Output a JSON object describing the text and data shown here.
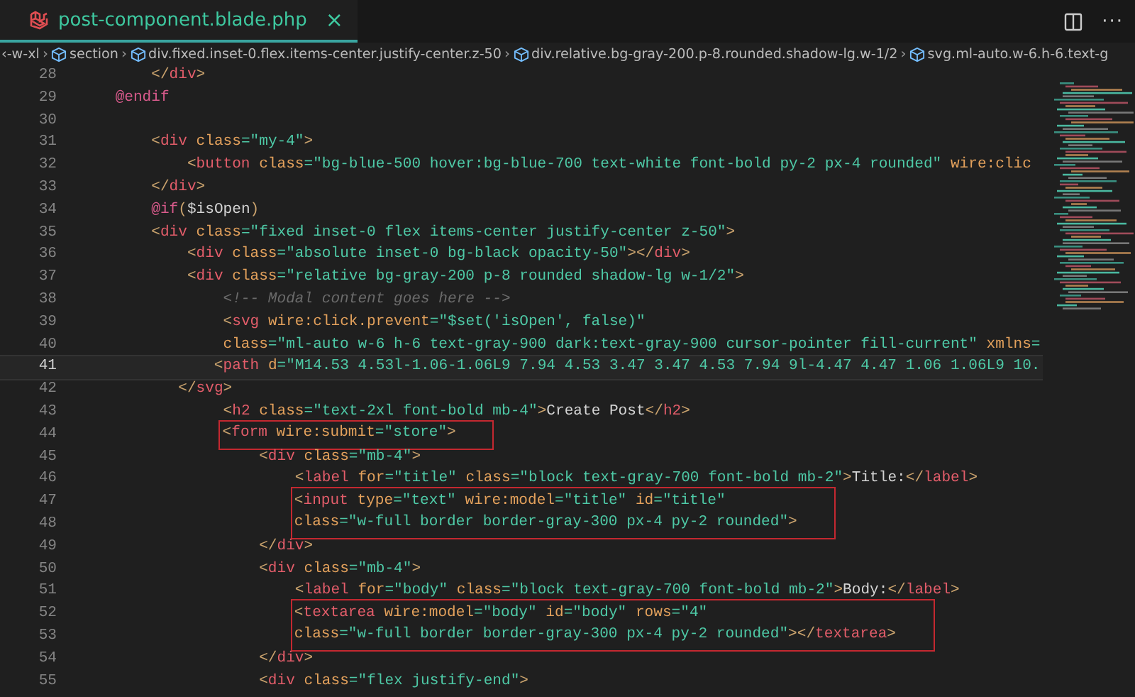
{
  "tab": {
    "title": "post-component.blade.php",
    "close": "×",
    "selected": true
  },
  "toolbar": {
    "more": "···"
  },
  "breadcrumbs": [
    {
      "kind": "plain",
      "text": "‹-w-xl"
    },
    {
      "kind": "symbol",
      "separator": "›",
      "text": "section"
    },
    {
      "kind": "symbol",
      "separator": "›",
      "text": "div.fixed.inset-0.flex.items-center.justify-center.z-50"
    },
    {
      "kind": "symbol",
      "separator": "›",
      "text": "div.relative.bg-gray-200.p-8.rounded.shadow-lg.w-1/2"
    },
    {
      "kind": "symbol",
      "separator": "›",
      "text": "svg.ml-auto.w-6.h-6.text-g"
    }
  ],
  "editor": {
    "blocks": [
      {
        "kind": "line",
        "number": "28",
        "current": false,
        "tokens": [
          {
            "kind": "lt",
            "text": "        </"
          },
          {
            "kind": "tag",
            "text": "div"
          },
          {
            "kind": "lt",
            "text": ">"
          }
        ]
      },
      {
        "kind": "line",
        "number": "29",
        "current": false,
        "tokens": [
          {
            "kind": "dir",
            "text": "    @endif"
          }
        ]
      },
      {
        "kind": "line",
        "number": "30",
        "current": false
      },
      {
        "kind": "line",
        "number": "31",
        "current": false,
        "tokens": [
          {
            "kind": "lt",
            "text": "        <"
          },
          {
            "kind": "tag",
            "text": "div"
          },
          {
            "kind": "attr",
            "text": " class"
          },
          {
            "kind": "str",
            "text": "=\"my-4\""
          },
          {
            "kind": "lt",
            "text": ">"
          }
        ]
      },
      {
        "kind": "line",
        "number": "32",
        "current": false,
        "tokens": [
          {
            "kind": "lt",
            "text": "            <"
          },
          {
            "kind": "tag",
            "text": "button"
          },
          {
            "kind": "attr",
            "text": " class"
          },
          {
            "kind": "str",
            "text": "=\"bg-blue-500 hover:bg-blue-700 text-white font-bold py-2 px-4 rounded\""
          },
          {
            "kind": "attr",
            "text": " wire:clic"
          }
        ]
      },
      {
        "kind": "line",
        "number": "33",
        "current": false,
        "tokens": [
          {
            "kind": "lt",
            "text": "        </"
          },
          {
            "kind": "tag",
            "text": "div"
          },
          {
            "kind": "lt",
            "text": ">"
          }
        ]
      },
      {
        "kind": "line",
        "number": "34",
        "current": false,
        "tokens": [
          {
            "kind": "dir",
            "text": "        @if"
          },
          {
            "kind": "lt",
            "text": "("
          },
          {
            "kind": "txt",
            "text": "$isOpen"
          },
          {
            "kind": "lt",
            "text": ")"
          }
        ]
      },
      {
        "kind": "line",
        "number": "35",
        "current": false,
        "tokens": [
          {
            "kind": "lt",
            "text": "        <"
          },
          {
            "kind": "tag",
            "text": "div"
          },
          {
            "kind": "attr",
            "text": " class"
          },
          {
            "kind": "str",
            "text": "=\"fixed inset-0 flex items-center justify-center z-50\""
          },
          {
            "kind": "lt",
            "text": ">"
          }
        ]
      },
      {
        "kind": "line",
        "number": "36",
        "current": false,
        "tokens": [
          {
            "kind": "lt",
            "text": "            <"
          },
          {
            "kind": "tag",
            "text": "div"
          },
          {
            "kind": "attr",
            "text": " class"
          },
          {
            "kind": "str",
            "text": "=\"absolute inset-0 bg-black opacity-50\""
          },
          {
            "kind": "lt",
            "text": "></"
          },
          {
            "kind": "tag",
            "text": "div"
          },
          {
            "kind": "lt",
            "text": ">"
          }
        ]
      },
      {
        "kind": "line",
        "number": "37",
        "current": false,
        "tokens": [
          {
            "kind": "lt",
            "text": "            <"
          },
          {
            "kind": "tag",
            "text": "div"
          },
          {
            "kind": "attr",
            "text": " class"
          },
          {
            "kind": "str",
            "text": "=\"relative bg-gray-200 p-8 rounded shadow-lg w-1/2\""
          },
          {
            "kind": "lt",
            "text": ">"
          }
        ]
      },
      {
        "kind": "line",
        "number": "38",
        "current": false,
        "tokens": [
          {
            "kind": "com",
            "text": "                <!-- Modal content goes here -->"
          }
        ]
      },
      {
        "kind": "line",
        "number": "39",
        "current": false,
        "tokens": [
          {
            "kind": "lt",
            "text": "                <"
          },
          {
            "kind": "tag",
            "text": "svg"
          },
          {
            "kind": "attr",
            "text": " wire:click.prevent"
          },
          {
            "kind": "str",
            "text": "=\"$set('isOpen', false)\""
          }
        ]
      },
      {
        "kind": "line",
        "number": "40",
        "current": false,
        "tokens": [
          {
            "kind": "attr",
            "text": "                class"
          },
          {
            "kind": "str",
            "text": "=\"ml-auto w-6 h-6 text-gray-900 dark:text-gray-900 cursor-pointer fill-current\""
          },
          {
            "kind": "attr",
            "text": " xmlns"
          },
          {
            "kind": "str",
            "text": "="
          }
        ]
      },
      {
        "kind": "line",
        "number": "41",
        "current": true,
        "tokens": [
          {
            "kind": "lt",
            "text": "               <"
          },
          {
            "kind": "tag",
            "text": "path"
          },
          {
            "kind": "attr",
            "text": " d"
          },
          {
            "kind": "str",
            "text": "=\"M14.53 4.53l-1.06-1.06L9 7.94 4.53 3.47 3.47 4.53 7.94 9l-4.47 4.47 1.06 1.06L9 10."
          }
        ]
      },
      {
        "kind": "line",
        "number": "42",
        "current": false,
        "tokens": [
          {
            "kind": "lt",
            "text": "           </"
          },
          {
            "kind": "tag",
            "text": "svg"
          },
          {
            "kind": "lt",
            "text": ">"
          }
        ]
      },
      {
        "kind": "line",
        "number": "43",
        "current": false,
        "tokens": [
          {
            "kind": "lt",
            "text": "                <"
          },
          {
            "kind": "tag",
            "text": "h2"
          },
          {
            "kind": "attr",
            "text": " class"
          },
          {
            "kind": "str",
            "text": "=\"text-2xl font-bold mb-4\""
          },
          {
            "kind": "lt",
            "text": ">"
          },
          {
            "kind": "txt",
            "text": "Create Post"
          },
          {
            "kind": "lt",
            "text": "</"
          },
          {
            "kind": "tag",
            "text": "h2"
          },
          {
            "kind": "lt",
            "text": ">"
          }
        ]
      },
      {
        "kind": "boxed",
        "lines": [
          {
            "number": "44",
            "current": false,
            "tokens": [
              {
                "kind": "lt",
                "text": "                <"
              },
              {
                "kind": "tag",
                "text": "form"
              },
              {
                "kind": "attr",
                "text": " wire:submit"
              },
              {
                "kind": "str",
                "text": "=\"store\""
              },
              {
                "kind": "lt",
                "text": ">"
              }
            ]
          }
        ]
      },
      {
        "kind": "line",
        "number": "45",
        "current": false,
        "tokens": [
          {
            "kind": "lt",
            "text": "                    <"
          },
          {
            "kind": "tag",
            "text": "div"
          },
          {
            "kind": "attr",
            "text": " class"
          },
          {
            "kind": "str",
            "text": "=\"mb-4\""
          },
          {
            "kind": "lt",
            "text": ">"
          }
        ]
      },
      {
        "kind": "line",
        "number": "46",
        "current": false,
        "tokens": [
          {
            "kind": "lt",
            "text": "                        <"
          },
          {
            "kind": "tag",
            "text": "label"
          },
          {
            "kind": "attr",
            "text": " for"
          },
          {
            "kind": "str",
            "text": "=\"title\""
          },
          {
            "kind": "attr",
            "text": " class"
          },
          {
            "kind": "str",
            "text": "=\"block text-gray-700 font-bold mb-2\""
          },
          {
            "kind": "lt",
            "text": ">"
          },
          {
            "kind": "txt",
            "text": "Title:"
          },
          {
            "kind": "lt",
            "text": "</"
          },
          {
            "kind": "tag",
            "text": "label"
          },
          {
            "kind": "lt",
            "text": ">"
          }
        ]
      },
      {
        "kind": "boxed",
        "lines": [
          {
            "number": "47",
            "current": false,
            "tokens": [
              {
                "kind": "lt",
                "text": "                        <"
              },
              {
                "kind": "tag",
                "text": "input"
              },
              {
                "kind": "attr",
                "text": " type"
              },
              {
                "kind": "str",
                "text": "=\"text\""
              },
              {
                "kind": "attr",
                "text": " wire:model"
              },
              {
                "kind": "str",
                "text": "=\"title\""
              },
              {
                "kind": "attr",
                "text": " id"
              },
              {
                "kind": "str",
                "text": "=\"title\""
              }
            ]
          },
          {
            "number": "48",
            "current": false,
            "tokens": [
              {
                "kind": "attr",
                "text": "                        class"
              },
              {
                "kind": "str",
                "text": "=\"w-full border border-gray-300 px-4 py-2 rounded\""
              },
              {
                "kind": "lt",
                "text": ">"
              }
            ]
          }
        ]
      },
      {
        "kind": "line",
        "number": "49",
        "current": false,
        "tokens": [
          {
            "kind": "lt",
            "text": "                    </"
          },
          {
            "kind": "tag",
            "text": "div"
          },
          {
            "kind": "lt",
            "text": ">"
          }
        ]
      },
      {
        "kind": "line",
        "number": "50",
        "current": false,
        "tokens": [
          {
            "kind": "lt",
            "text": "                    <"
          },
          {
            "kind": "tag",
            "text": "div"
          },
          {
            "kind": "attr",
            "text": " class"
          },
          {
            "kind": "str",
            "text": "=\"mb-4\""
          },
          {
            "kind": "lt",
            "text": ">"
          }
        ]
      },
      {
        "kind": "line",
        "number": "51",
        "current": false,
        "tokens": [
          {
            "kind": "lt",
            "text": "                        <"
          },
          {
            "kind": "tag",
            "text": "label"
          },
          {
            "kind": "attr",
            "text": " for"
          },
          {
            "kind": "str",
            "text": "=\"body\""
          },
          {
            "kind": "attr",
            "text": " class"
          },
          {
            "kind": "str",
            "text": "=\"block text-gray-700 font-bold mb-2\""
          },
          {
            "kind": "lt",
            "text": ">"
          },
          {
            "kind": "txt",
            "text": "Body:"
          },
          {
            "kind": "lt",
            "text": "</"
          },
          {
            "kind": "tag",
            "text": "label"
          },
          {
            "kind": "lt",
            "text": ">"
          }
        ]
      },
      {
        "kind": "boxed",
        "lines": [
          {
            "number": "52",
            "current": false,
            "tokens": [
              {
                "kind": "lt",
                "text": "                        <"
              },
              {
                "kind": "tag",
                "text": "textarea"
              },
              {
                "kind": "attr",
                "text": " wire:model"
              },
              {
                "kind": "str",
                "text": "=\"body\""
              },
              {
                "kind": "attr",
                "text": " id"
              },
              {
                "kind": "str",
                "text": "=\"body\""
              },
              {
                "kind": "attr",
                "text": " rows"
              },
              {
                "kind": "str",
                "text": "=\"4\""
              }
            ]
          },
          {
            "number": "53",
            "current": false,
            "tokens": [
              {
                "kind": "attr",
                "text": "                        class"
              },
              {
                "kind": "str",
                "text": "=\"w-full border border-gray-300 px-4 py-2 rounded\""
              },
              {
                "kind": "lt",
                "text": "></"
              },
              {
                "kind": "tag",
                "text": "textarea"
              },
              {
                "kind": "lt",
                "text": ">"
              }
            ]
          }
        ]
      },
      {
        "kind": "line",
        "number": "54",
        "current": false,
        "tokens": [
          {
            "kind": "lt",
            "text": "                    </"
          },
          {
            "kind": "tag",
            "text": "div"
          },
          {
            "kind": "lt",
            "text": ">"
          }
        ]
      },
      {
        "kind": "line",
        "number": "55",
        "current": false,
        "tokens": [
          {
            "kind": "lt",
            "text": "                    <"
          },
          {
            "kind": "tag",
            "text": "div"
          },
          {
            "kind": "attr",
            "text": " class"
          },
          {
            "kind": "str",
            "text": "=\"flex justify-end\""
          },
          {
            "kind": "lt",
            "text": ">"
          }
        ]
      }
    ]
  }
}
